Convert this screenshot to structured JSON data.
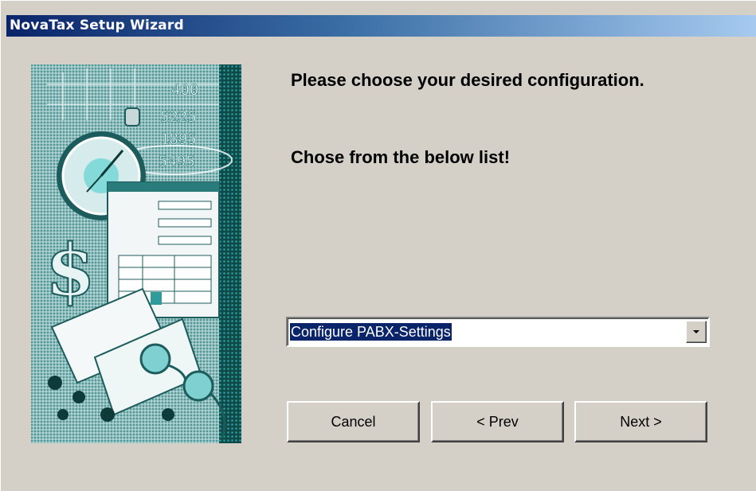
{
  "window": {
    "title": "NovaTax Setup Wizard"
  },
  "content": {
    "heading": "Please choose your desired configuration.",
    "subheading": "Chose from the below list!"
  },
  "config_select": {
    "selected_value": "Configure PABX-Settings",
    "dropdown_icon": "chevron-down-icon"
  },
  "buttons": {
    "cancel_label": "Cancel",
    "prev_label": "< Prev",
    "next_label": "Next >"
  },
  "banner": {
    "numbers": [
      "400",
      "5225",
      "1895",
      "5495"
    ]
  },
  "colors": {
    "titlebar_start": "#0a246a",
    "titlebar_end": "#a6caf0",
    "dialog_face": "#d4d0c8",
    "selection": "#0a246a",
    "banner_teal": "#2f9c9c"
  }
}
